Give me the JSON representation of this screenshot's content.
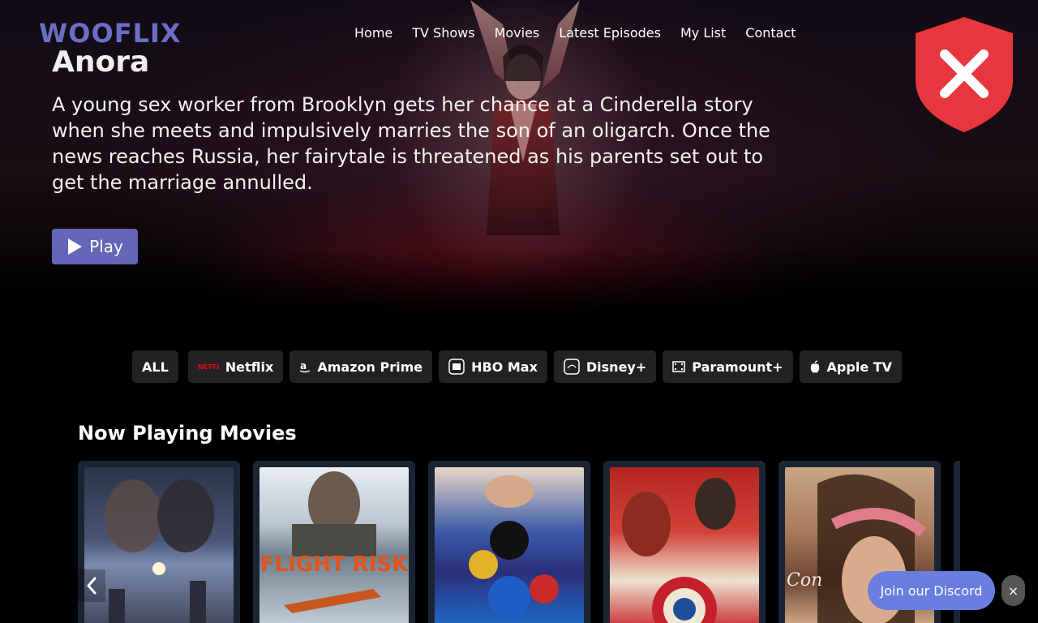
{
  "brand": {
    "logo": "WOOFLIX",
    "accent": "#6b6fc4"
  },
  "nav": {
    "items": [
      "Home",
      "TV Shows",
      "Movies",
      "Latest Episodes",
      "My List",
      "Contact"
    ]
  },
  "hero": {
    "title": "Anora",
    "description": "A young sex worker from Brooklyn gets her chance at a Cinderella story when she meets and impulsively marries the son of an oligarch. Once the news reaches Russia, her fairytale is threatened as his parents set out to get the marriage annulled.",
    "play_label": "Play"
  },
  "badge": {
    "icon": "shield-x-icon",
    "color": "#e8363f"
  },
  "filters": {
    "items": [
      {
        "label": "ALL",
        "icon": ""
      },
      {
        "label": "Netflix",
        "icon": "netflix-logo-icon"
      },
      {
        "label": "Amazon Prime",
        "icon": "amazon-icon"
      },
      {
        "label": "HBO Max",
        "icon": "hbo-icon"
      },
      {
        "label": "Disney+",
        "icon": "disney-icon"
      },
      {
        "label": "Paramount+",
        "icon": "film-icon"
      },
      {
        "label": "Apple TV",
        "icon": "apple-icon"
      }
    ],
    "netflix_wordmark": "NETFLIX"
  },
  "section": {
    "title": "Now Playing Movies",
    "poster_texts": [
      "FLIGHT RISK",
      "Con"
    ]
  },
  "discord": {
    "label": "Join our Discord",
    "close": "×"
  }
}
